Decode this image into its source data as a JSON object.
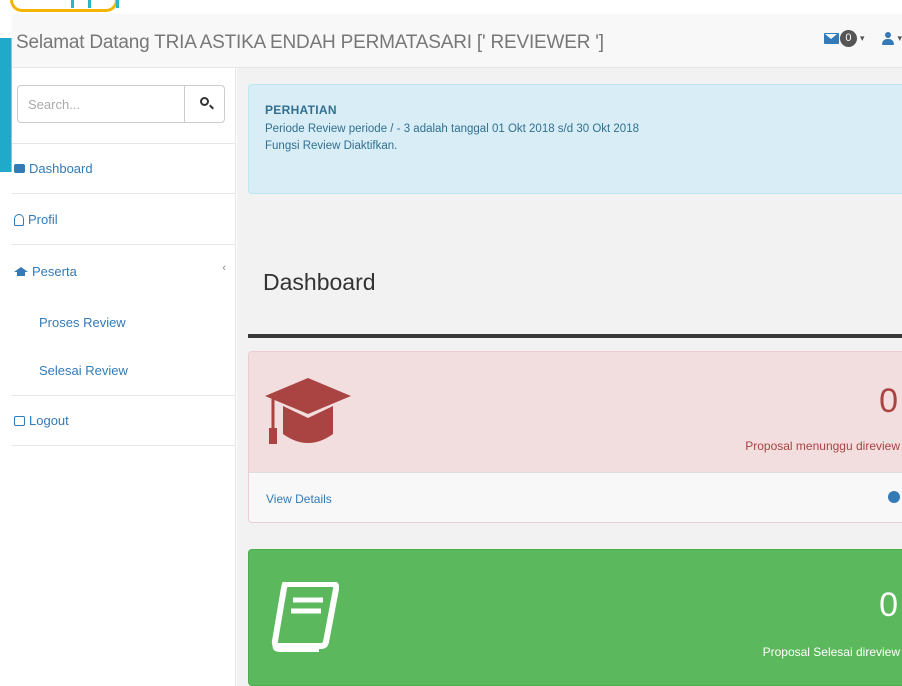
{
  "header": {
    "welcome": "Selamat Datang TRIA ASTIKA ENDAH PERMATASARI [' REVIEWER ']",
    "message_count": "0"
  },
  "sidebar": {
    "search_placeholder": "Search...",
    "items": [
      {
        "label": "Dashboard",
        "icon": "dashboard-icon"
      },
      {
        "label": "Profil",
        "icon": "user-icon"
      },
      {
        "label": "Peserta",
        "icon": "graduation-cap-icon"
      },
      {
        "label": "Proses Review"
      },
      {
        "label": "Selesai Review"
      },
      {
        "label": "Logout",
        "icon": "logout-icon"
      }
    ]
  },
  "alert": {
    "title": "PERHATIAN",
    "line1": "Periode Review periode / - 3 adalah tanggal 01 Okt 2018 s/d 30 Okt 2018",
    "line2": "Fungsi Review Diaktifkan."
  },
  "main": {
    "title": "Dashboard"
  },
  "panels": [
    {
      "count": "0",
      "label": "Proposal menunggu direview",
      "link": "View Details",
      "color": "#f2dede",
      "icon": "graduation-cap-icon"
    },
    {
      "count": "0",
      "label": "Proposal Selesai direview",
      "color": "#5cb85c",
      "icon": "book-icon"
    }
  ],
  "colors": {
    "accent": "#337ab7",
    "alert_bg": "#d9edf7",
    "danger_text": "#a94442",
    "success": "#5cb85c"
  }
}
